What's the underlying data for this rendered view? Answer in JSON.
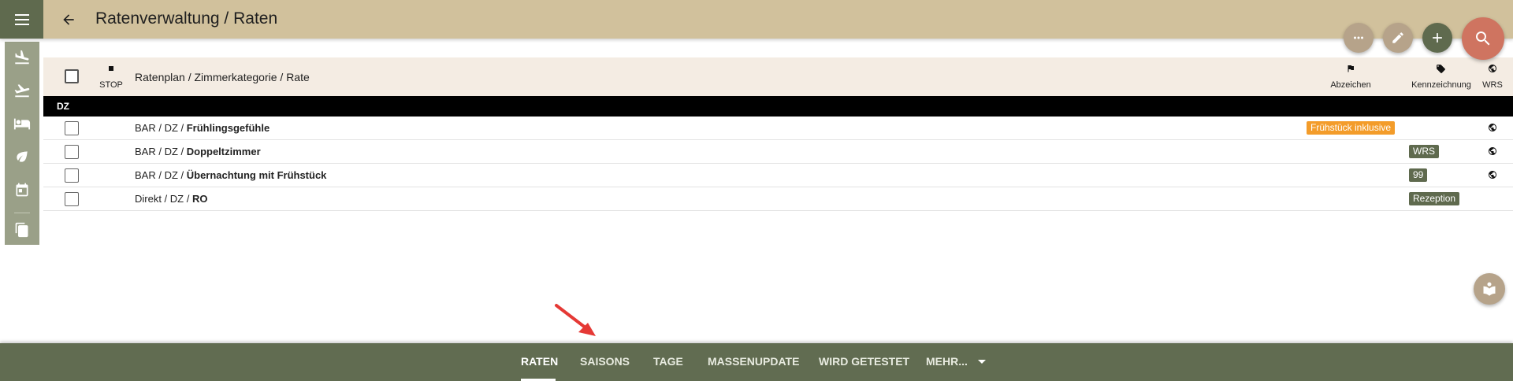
{
  "header": {
    "title": "Ratenverwaltung / Raten",
    "menu_icon": "hamburger-menu-icon",
    "back_icon": "arrow-back-icon"
  },
  "sidebar": {
    "items": [
      {
        "icon": "flight-land-icon"
      },
      {
        "icon": "flight-takeoff-icon"
      },
      {
        "icon": "bed-icon"
      },
      {
        "icon": "leaf-icon"
      },
      {
        "icon": "calendar-icon"
      },
      {
        "icon": "copy-icon"
      }
    ]
  },
  "fabs": [
    {
      "icon": "more-horiz-icon",
      "color": "#b6a38a"
    },
    {
      "icon": "edit-icon",
      "color": "#b6a38a"
    },
    {
      "icon": "add-icon",
      "color": "#5f6a4e"
    },
    {
      "icon": "search-icon",
      "color": "#cf7460"
    }
  ],
  "table": {
    "columns": {
      "stop": "STOP",
      "name": "Ratenplan / Zimmerkategorie / Rate",
      "abzeichen": "Abzeichen",
      "kennzeichnung": "Kennzeichnung",
      "wrs": "WRS"
    },
    "group": "DZ",
    "rows": [
      {
        "prefix": "BAR / DZ / ",
        "rate": "Frühlingsgefühle",
        "abzeichen": "Frühstück inklusive",
        "kennzeichnung": "",
        "wrs": true
      },
      {
        "prefix": "BAR / DZ / ",
        "rate": "Doppeltzimmer",
        "abzeichen": "",
        "kennzeichnung": "WRS",
        "wrs": true
      },
      {
        "prefix": "BAR / DZ / ",
        "rate": "Übernachtung mit Frühstück",
        "abzeichen": "",
        "kennzeichnung": "99",
        "wrs": true
      },
      {
        "prefix": "Direkt / DZ / ",
        "rate": "RO",
        "abzeichen": "",
        "kennzeichnung": "Rezeption",
        "wrs": false
      }
    ]
  },
  "bottom_nav": {
    "tabs": [
      "RATEN",
      "SAISONS",
      "TAGE",
      "MASSENUPDATE",
      "WIRD GETESTET",
      "MEHR..."
    ],
    "active": "RATEN"
  },
  "colors": {
    "header": "#d1c19c",
    "nav": "#616c51",
    "accent_orange": "#f39c2a",
    "olive": "#5f6a4e"
  }
}
